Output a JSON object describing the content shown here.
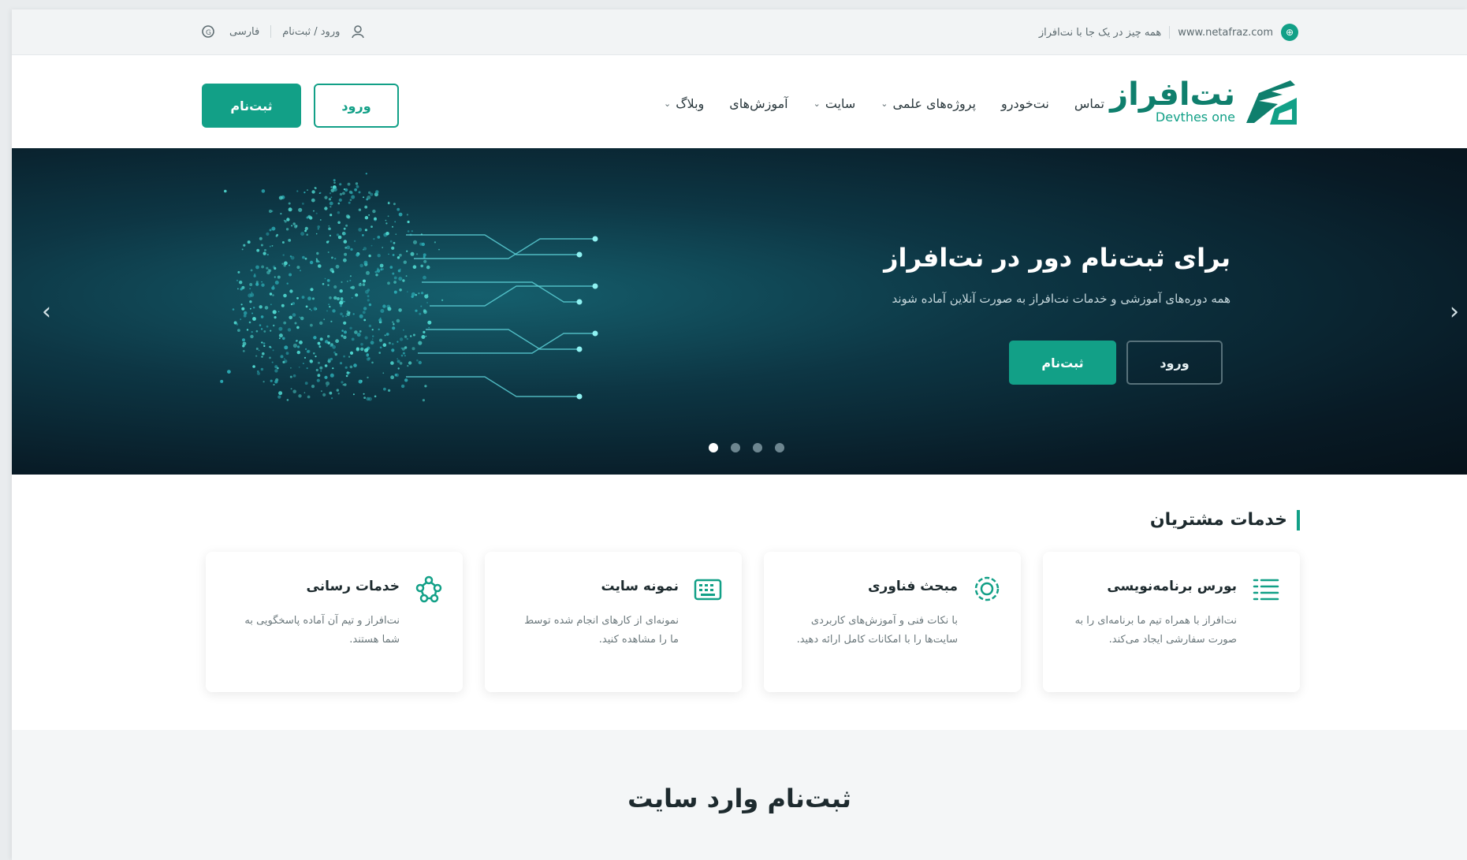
{
  "topbar": {
    "website": "www.netafraz.com",
    "tagline": "همه چیز در یک جا با نت‌افراز",
    "user_link": "ورود / ثبت‌نام",
    "lang": "فارسی",
    "icon_globe": "globe-icon",
    "icon_user": "user-icon",
    "icon_lang": "language-icon"
  },
  "header": {
    "logo_fa": "نت‌افراز",
    "logo_en": "Devthes one",
    "nav": [
      {
        "label": "تماس",
        "has_dropdown": false
      },
      {
        "label": "نت‌خودرو",
        "has_dropdown": false
      },
      {
        "label": "پروژه‌های علمی",
        "has_dropdown": true
      },
      {
        "label": "سایت",
        "has_dropdown": true
      },
      {
        "label": "آموزش‌های",
        "has_dropdown": false
      },
      {
        "label": "وبلاگ",
        "has_dropdown": true
      }
    ],
    "login_label": "ورود",
    "signup_label": "ثبت‌نام"
  },
  "hero": {
    "title": "برای ثبت‌نام دور در نت‌افراز",
    "subtitle": "همه دوره‌های آموزشی و خدمات نت‌افراز به صورت آنلاین آماده شوند",
    "signup_label": "ثبت‌نام",
    "login_label": "ورود",
    "slides_count": 4,
    "active_slide": 1
  },
  "services": {
    "title": "خدمات مشتریان",
    "cards": [
      {
        "title": "بورس برنامه‌نویسی",
        "desc": "نت‌افراز با همراه تیم ما برنامه‌ای را به صورت سفارشی ایجاد می‌کند.",
        "icon": "list-icon"
      },
      {
        "title": "مبحث فناوری",
        "desc": "با نکات فنی و آموزش‌های کاربردی سایت‌ها را با امکانات کامل ارائه دهید.",
        "icon": "gear-icon"
      },
      {
        "title": "نمونه سایت",
        "desc": "نمونه‌ای از کارهای انجام شده توسط ما را مشاهده کنید.",
        "icon": "keyboard-icon"
      },
      {
        "title": "خدمات رسانی",
        "desc": "نت‌افراز و تیم آن آماده پاسخگویی به شما هستند.",
        "icon": "network-icon"
      }
    ]
  },
  "section2": {
    "title": "ثبت‌نام وارد سایت"
  },
  "colors": {
    "accent": "#12a087",
    "hero_dark": "#081a25"
  }
}
